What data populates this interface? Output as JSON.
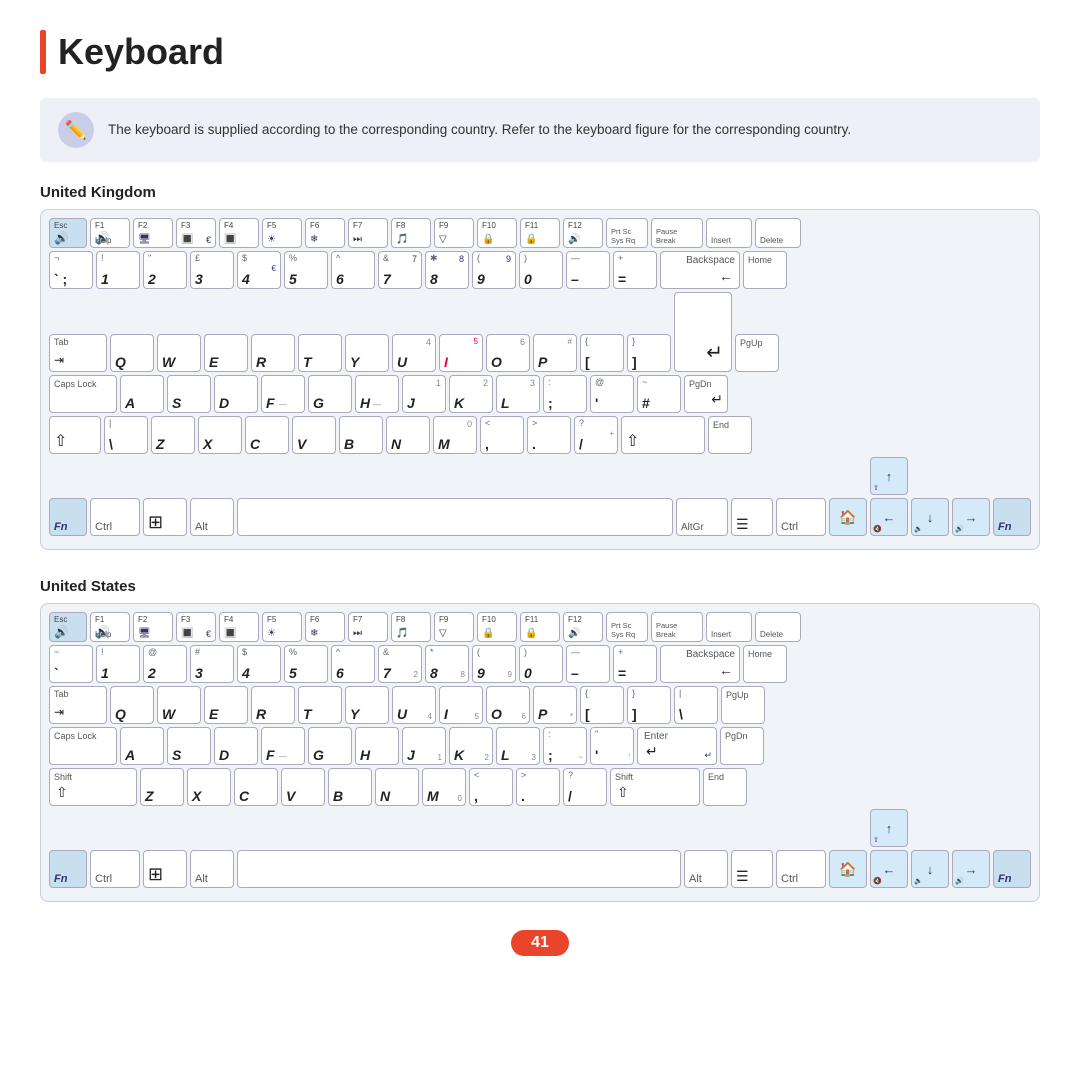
{
  "title": "Keyboard",
  "notice": "The keyboard is supplied according to the corresponding country. Refer to the keyboard figure for the corresponding country.",
  "page_number": "41",
  "sections": [
    {
      "id": "uk",
      "label": "United Kingdom"
    },
    {
      "id": "us",
      "label": "United States"
    }
  ]
}
